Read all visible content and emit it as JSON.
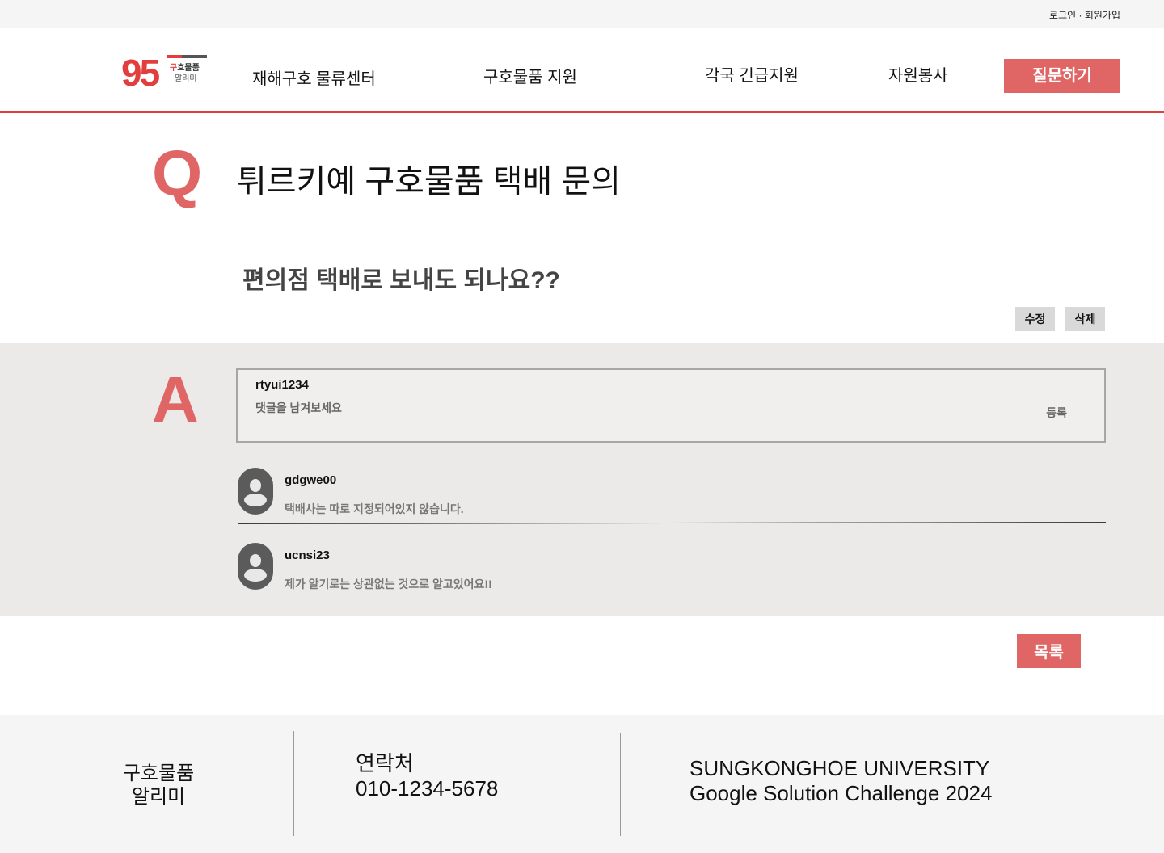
{
  "topbar": {
    "login": "로그인",
    "separator": " · ",
    "signup": "회원가입"
  },
  "header": {
    "logo": {
      "number_nine": "9",
      "number_five": "5",
      "line1_red": "구",
      "line1_rest": "호물품",
      "line2": "알리미"
    },
    "nav": [
      {
        "label": "재해구호 물류센터"
      },
      {
        "label": "구호물품 지원"
      },
      {
        "label": "각국 긴급지원"
      },
      {
        "label": "자원봉사"
      }
    ],
    "ask_button": "질문하기"
  },
  "question": {
    "letter": "Q",
    "title": "튀르키예 구호물품 택배 문의",
    "body": "편의점 택배로 보내도 되나요??",
    "edit_button": "수정",
    "delete_button": "삭제"
  },
  "answer": {
    "letter": "A",
    "reply_box": {
      "user": "rtyui1234",
      "placeholder": "댓글을 남겨보세요",
      "submit": "등록"
    },
    "comments": [
      {
        "user": "gdgwe00",
        "text": "택배사는 따로 지정되어있지 않습니다."
      },
      {
        "user": "ucnsi23",
        "text": "제가 알기로는 상관없는 것으로 알고있어요!!"
      }
    ]
  },
  "list_button": "목록",
  "footer": {
    "brand_line1": "구호물품",
    "brand_line2": "알리미",
    "contact_label": "연락처",
    "contact_phone": "010-1234-5678",
    "org_line1": "SUNGKONGHOE UNIVERSITY",
    "org_line2": "Google Solution Challenge 2024"
  },
  "colors": {
    "accent": "#e06666",
    "accent_line": "#e33e3e",
    "answer_bg": "#ebeae8",
    "footer_bg": "#f5f5f5"
  }
}
